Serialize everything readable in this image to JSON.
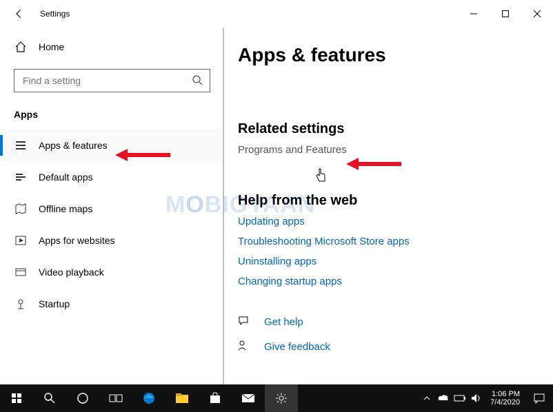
{
  "window": {
    "title": "Settings"
  },
  "sidebar": {
    "home_label": "Home",
    "search_placeholder": "Find a setting",
    "category": "Apps",
    "items": [
      {
        "label": "Apps & features",
        "icon": "apps-features-icon",
        "selected": true
      },
      {
        "label": "Default apps",
        "icon": "default-apps-icon",
        "selected": false
      },
      {
        "label": "Offline maps",
        "icon": "offline-maps-icon",
        "selected": false
      },
      {
        "label": "Apps for websites",
        "icon": "apps-websites-icon",
        "selected": false
      },
      {
        "label": "Video playback",
        "icon": "video-playback-icon",
        "selected": false
      },
      {
        "label": "Startup",
        "icon": "startup-icon",
        "selected": false
      }
    ]
  },
  "content": {
    "page_title": "Apps & features",
    "related_heading": "Related settings",
    "related_link": "Programs and Features",
    "help_heading": "Help from the web",
    "help_links": [
      "Updating apps",
      "Troubleshooting Microsoft Store apps",
      "Uninstalling apps",
      "Changing startup apps"
    ],
    "get_help": "Get help",
    "give_feedback": "Give feedback"
  },
  "taskbar": {
    "time": "1:06 PM",
    "date": "7/4/2020"
  },
  "watermark": "MOBIGYAAN"
}
